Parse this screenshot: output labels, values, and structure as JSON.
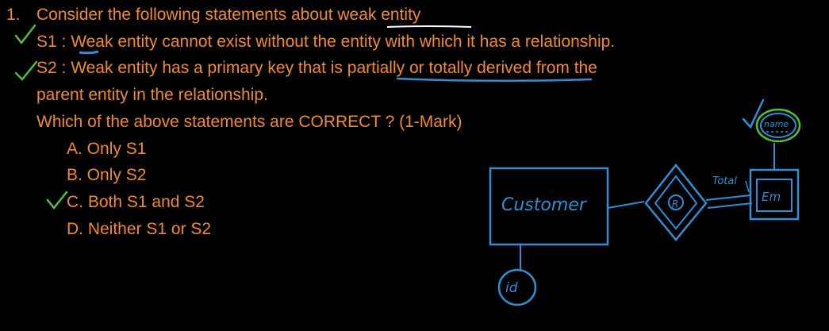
{
  "question": {
    "number": "1.",
    "stem": "Consider the following statements about weak entity",
    "s1": "S1 : Weak entity cannot exist without the entity with which it has a relationship.",
    "s2_line1": "S2 : Weak entity has a primary key that is partially or totally derived from the",
    "s2_line2": "parent entity in the relationship.",
    "prompt": "Which of the above statements are CORRECT ? (1-Mark)",
    "options": [
      {
        "label": "A. Only S1"
      },
      {
        "label": "B. Only S2"
      },
      {
        "label": "C. Both S1 and S2"
      },
      {
        "label": "D. Neither S1 or S2"
      }
    ]
  },
  "annotations": {
    "customer_entity": "Customer",
    "relationship": "R",
    "weak_entity": "Em",
    "attribute_id": "id",
    "attribute_name": "name",
    "participation": "Total"
  },
  "colors": {
    "text": "#f28a2e",
    "ink_blue": "#2f8fd6",
    "ink_green": "#4fc23a",
    "background": "#000000"
  }
}
